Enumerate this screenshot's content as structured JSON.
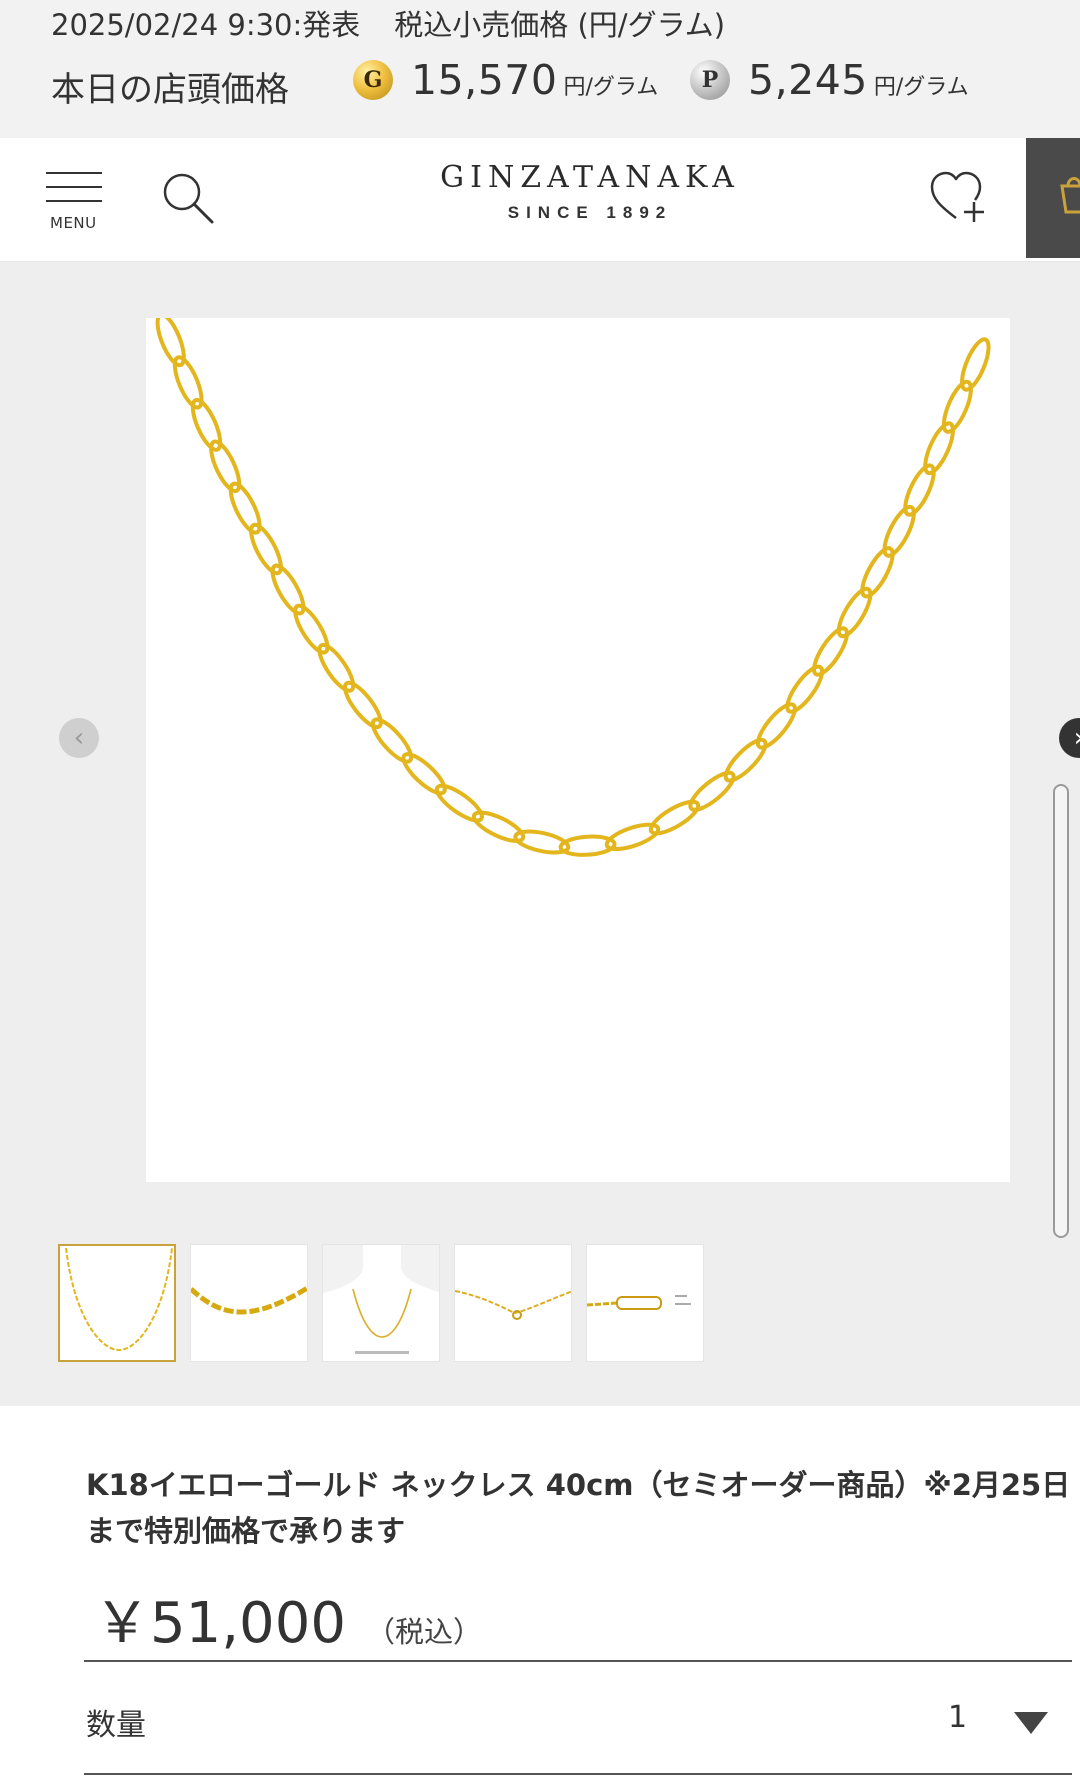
{
  "price_header": {
    "announce_date": "2025/02/24 9:30:発表",
    "announce_note": "税込小売価格 (円/グラム)",
    "today_label": "本日の店頭価格",
    "gold": {
      "icon": "gold-coin-icon",
      "letter": "G",
      "value": "15,570",
      "unit": "円/グラム"
    },
    "platinum": {
      "icon": "platinum-coin-icon",
      "letter": "P",
      "value": "5,245",
      "unit": "円/グラム"
    }
  },
  "nav": {
    "menu_label": "MENU",
    "logo_main": "GINZATANAKA",
    "logo_sub": "SINCE 1892",
    "icons": [
      "hamburger-icon",
      "search-icon",
      "wishlist-heart-icon",
      "cart-icon"
    ]
  },
  "gallery": {
    "prev_symbol": "‹",
    "next_symbol": "›",
    "thumbnail_count": 5,
    "active_thumbnail": 1
  },
  "product": {
    "title": "K18イエローゴールド ネックレス 40cm（セミオーダー商品）※2月25日まで特別価格で承ります",
    "price": "￥51,000",
    "tax_note": "（税込）",
    "quantity_label": "数量",
    "quantity_value": "1"
  },
  "colors": {
    "gold_chain": "#e2b61c",
    "header_bg": "#f2f2f2",
    "gallery_bg": "#eeeeee",
    "cart_bg": "#4a4a4a",
    "active_thumb_border": "#c9a33a"
  }
}
